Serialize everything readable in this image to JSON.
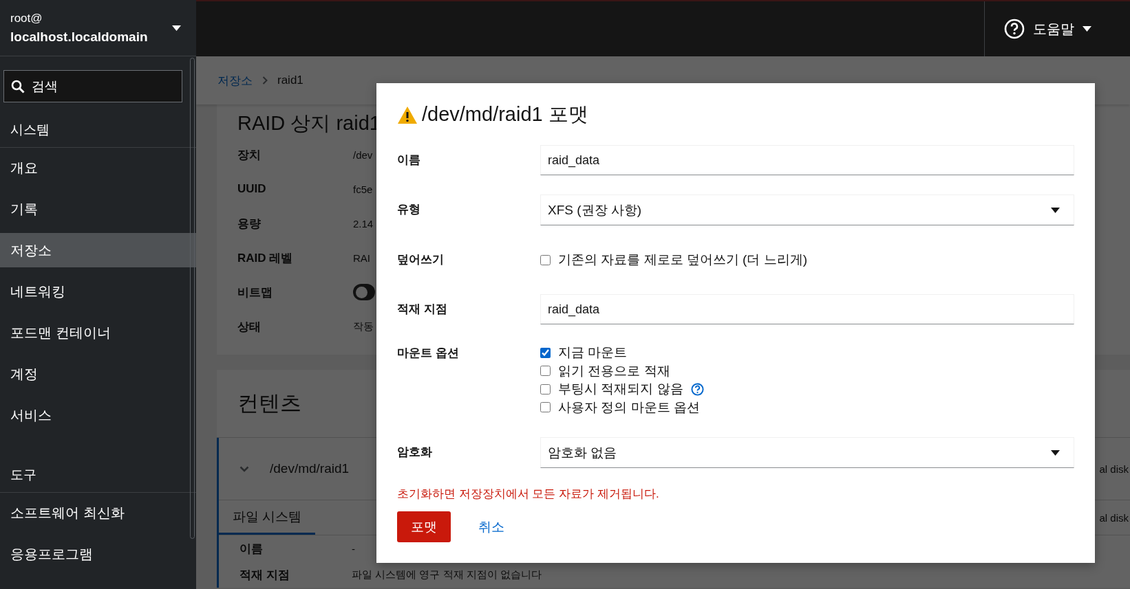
{
  "host": {
    "user": "root@",
    "name": "localhost.localdomain"
  },
  "search": {
    "placeholder": "검색"
  },
  "nav": [
    {
      "kind": "header",
      "label": "시스템"
    },
    {
      "kind": "item",
      "label": "개요",
      "selected": false
    },
    {
      "kind": "item",
      "label": "기록",
      "selected": false
    },
    {
      "kind": "item",
      "label": "저장소",
      "selected": true
    },
    {
      "kind": "item",
      "label": "네트워킹",
      "selected": false
    },
    {
      "kind": "item",
      "label": "포드맨 컨테이너",
      "selected": false
    },
    {
      "kind": "item",
      "label": "계정",
      "selected": false
    },
    {
      "kind": "item",
      "label": "서비스",
      "selected": false
    },
    {
      "kind": "header",
      "label": "도구"
    },
    {
      "kind": "item",
      "label": "소프트웨어 최신화",
      "selected": false
    },
    {
      "kind": "item",
      "label": "응용프로그램",
      "selected": false
    }
  ],
  "help": {
    "label": "도움말"
  },
  "breadcrumb": [
    {
      "kind": "link",
      "label": "저장소"
    },
    {
      "kind": "current",
      "label": "raid1"
    }
  ],
  "device_card": {
    "title": "RAID 상지 raid1",
    "rows": [
      {
        "kind": "text",
        "label": "장치",
        "value": "/dev"
      },
      {
        "kind": "text",
        "label": "UUID",
        "value": "fc5e"
      },
      {
        "kind": "text",
        "label": "용량",
        "value": "2.14"
      },
      {
        "kind": "text",
        "label": "RAID 레벨",
        "value": "RAI"
      },
      {
        "kind": "switch",
        "label": "비트맵",
        "on": false
      },
      {
        "kind": "text",
        "label": "상태",
        "value": "작동"
      }
    ]
  },
  "contents_card": {
    "title": "컨텐츠",
    "row": {
      "name": "/dev/md/raid1",
      "expanded": true,
      "column_2": "al disk"
    },
    "tabs": [
      {
        "label": "파일 시스템",
        "selected": true
      }
    ],
    "tabs_column_2": "al disk",
    "details": [
      {
        "label": "이름",
        "value": "-"
      },
      {
        "label": "적재 지점",
        "value": "파일 시스템에 영구 적재 지점이 없습니다"
      }
    ]
  },
  "dialog": {
    "title": "/dev/md/raid1 포맷",
    "fields": [
      {
        "kind": "text",
        "label": "이름",
        "value": "raid_data"
      },
      {
        "kind": "select",
        "label": "유형",
        "value": "XFS (권장 사항)"
      },
      {
        "kind": "checkboxes",
        "label": "덮어쓰기",
        "options": [
          {
            "label": "기존의 자료를 제로로 덮어쓰기 (더 느리게)",
            "checked": false,
            "help": false
          }
        ]
      },
      {
        "kind": "text",
        "label": "적재 지점",
        "value": "raid_data"
      },
      {
        "kind": "checkboxes",
        "label": "마운트 옵션",
        "options": [
          {
            "label": "지금 마운트",
            "checked": true,
            "help": false
          },
          {
            "label": "읽기 전용으로 적재",
            "checked": false,
            "help": false
          },
          {
            "label": "부팅시 적재되지 않음",
            "checked": false,
            "help": true
          },
          {
            "label": "사용자 정의 마운트 옵션",
            "checked": false,
            "help": false
          }
        ]
      },
      {
        "kind": "select",
        "label": "암호화",
        "value": "암호화 없음"
      }
    ],
    "warning": "초기화하면 저장장치에서 모든 자료가 제거됩니다.",
    "buttons": [
      {
        "kind": "danger",
        "label": "포맷"
      },
      {
        "kind": "link",
        "label": "취소"
      }
    ]
  }
}
